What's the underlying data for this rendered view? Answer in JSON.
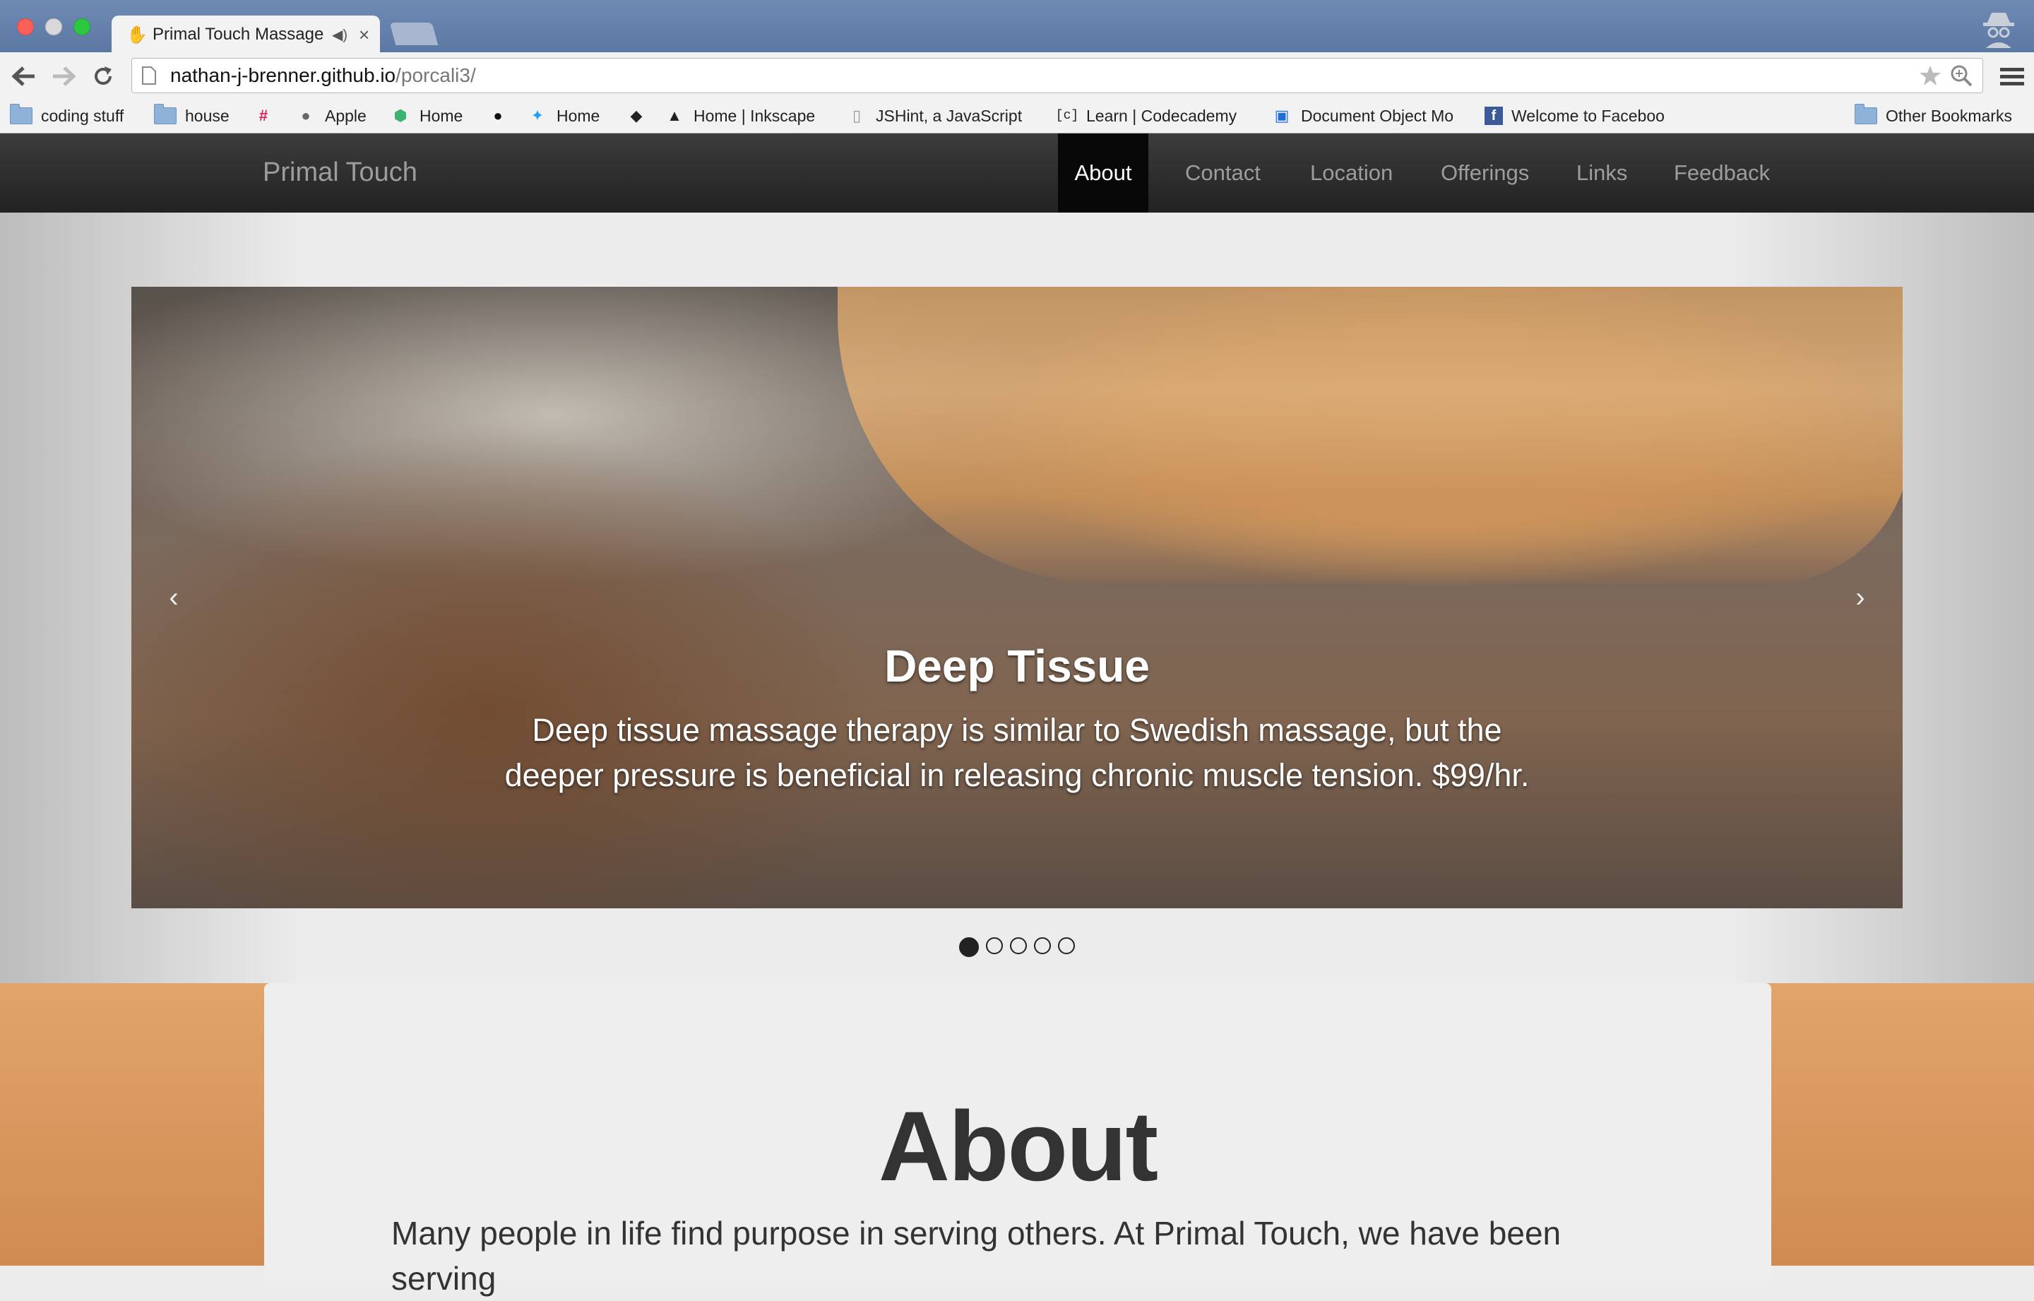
{
  "browser": {
    "tab_title": "Primal Touch Massage",
    "url_host": "nathan-j-brenner.github.io",
    "url_path": "/porcali3/",
    "bookmarks": [
      {
        "label": "coding stuff",
        "icon": "folder-icon"
      },
      {
        "label": "house",
        "icon": "folder-icon"
      },
      {
        "label": "",
        "icon": "slack-icon"
      },
      {
        "label": "Apple",
        "icon": "apple-icon"
      },
      {
        "label": "Home",
        "icon": "codeship-icon"
      },
      {
        "label": "",
        "icon": "github-icon"
      },
      {
        "label": "Home",
        "icon": "twitter-icon"
      },
      {
        "label": "",
        "icon": "gem-icon"
      },
      {
        "label": "Home | Inkscape",
        "icon": "inkscape-icon"
      },
      {
        "label": "JSHint, a JavaScript",
        "icon": "page-icon"
      },
      {
        "label": "Learn | Codecademy",
        "icon": "codecademy-icon"
      },
      {
        "label": "Document Object Mo",
        "icon": "dom-icon"
      },
      {
        "label": "Welcome to Faceboo",
        "icon": "facebook-icon"
      }
    ],
    "other_bookmarks": "Other Bookmarks"
  },
  "site": {
    "brand": "Primal Touch",
    "nav": [
      "About",
      "Contact",
      "Location",
      "Offerings",
      "Links",
      "Feedback"
    ],
    "active_nav": "About"
  },
  "carousel": {
    "title": "Deep Tissue",
    "text": "Deep tissue massage therapy is similar to Swedish massage, but the deeper pressure is beneficial in releasing chronic muscle tension. $99/hr.",
    "slide_count": 5,
    "active_slide": 1
  },
  "about": {
    "title": "About",
    "text": "Many people in life find purpose in serving others. At Primal Touch, we have been serving"
  },
  "colors": {
    "navbar": "#222222",
    "about_bg": "#d99a60"
  }
}
